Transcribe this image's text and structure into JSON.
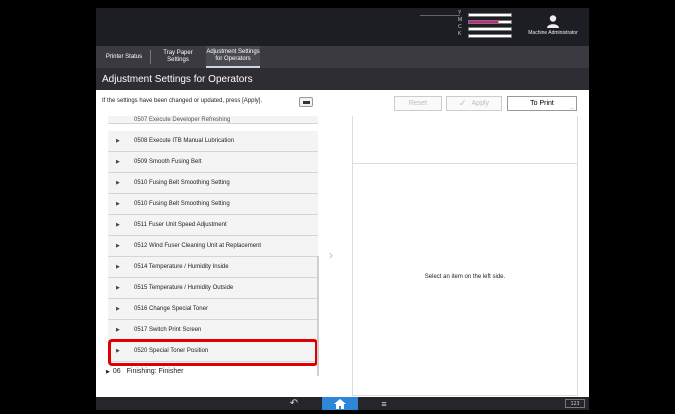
{
  "status": {
    "toners": [
      {
        "letter": "Y"
      },
      {
        "letter": "M"
      },
      {
        "letter": "C"
      },
      {
        "letter": "K"
      }
    ],
    "user_label": "Machine Administrator"
  },
  "tabs": [
    {
      "label": "Printer Status"
    },
    {
      "label": "Tray Paper Settings"
    },
    {
      "label": "Adjustment Settings for Operators"
    }
  ],
  "page_title": "Adjustment Settings for Operators",
  "toolbar": {
    "hint": "If the settings have been changed or updated, press [Apply].",
    "reset_label": "Reset",
    "apply_label": "Apply",
    "print_label": "To Print"
  },
  "list": {
    "partial_label": "0507 Execute Developer Refreshing",
    "items": [
      {
        "label": "0508 Execute ITB Manual Lubrication"
      },
      {
        "label": "0509 Smooth Fusing Belt"
      },
      {
        "label": "0510 Fusing Belt Smoothing Setting"
      },
      {
        "label": "0510 Fusing Belt Smoothing Setting"
      },
      {
        "label": "0511 Fuser Unit Speed Adjustment"
      },
      {
        "label": "0512 Wind Fuser Cleaning Unit at Replacement"
      },
      {
        "label": "0514 Temperature / Humidity Inside"
      },
      {
        "label": "0515 Temperature / Humidity Outside"
      },
      {
        "label": "0516 Change Special Toner"
      },
      {
        "label": "0517 Switch Print Screen"
      },
      {
        "label": "0520 Special Toner Position"
      }
    ],
    "category": {
      "number": "06",
      "label": "Finishing: Finisher"
    }
  },
  "detail": {
    "message": "Select an item on the left side."
  },
  "bottom": {
    "counter": "123"
  },
  "colors": {
    "highlight": "#e00000",
    "home": "#2f86d9",
    "magenta": "#e0158b"
  }
}
